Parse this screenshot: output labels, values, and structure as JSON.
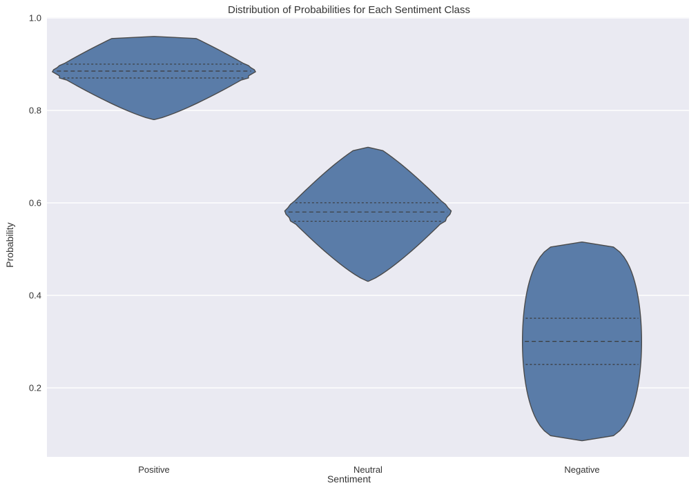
{
  "title": "Distribution of Probabilities for Each Sentiment Class",
  "xlabel": "Sentiment",
  "ylabel": "Probability",
  "yticks": {
    "values": [
      0.2,
      0.4,
      0.6,
      0.8,
      1.0
    ],
    "labels": [
      "0.2",
      "0.4",
      "0.6",
      "0.8",
      "1.0"
    ]
  },
  "xticks": {
    "labels": [
      "Positive",
      "Neutral",
      "Negative"
    ]
  },
  "violin_color": "#5a7ca8",
  "violin_stroke": "#4a4a4a",
  "chart_data": {
    "type": "violin",
    "xlabel": "Sentiment",
    "ylabel": "Probability",
    "ylim": [
      0.05,
      1.0
    ],
    "categories": [
      "Positive",
      "Neutral",
      "Negative"
    ],
    "distributions": [
      {
        "name": "Positive",
        "q1": 0.87,
        "median": 0.885,
        "q3": 0.9,
        "min_extent": 0.78,
        "max_extent": 0.96,
        "width_scale": 1.0
      },
      {
        "name": "Neutral",
        "q1": 0.56,
        "median": 0.58,
        "q3": 0.6,
        "min_extent": 0.43,
        "max_extent": 0.72,
        "width_scale": 0.82
      },
      {
        "name": "Negative",
        "q1": 0.25,
        "median": 0.3,
        "q3": 0.35,
        "min_extent": 0.085,
        "max_extent": 0.515,
        "width_scale": 0.58
      }
    ]
  }
}
